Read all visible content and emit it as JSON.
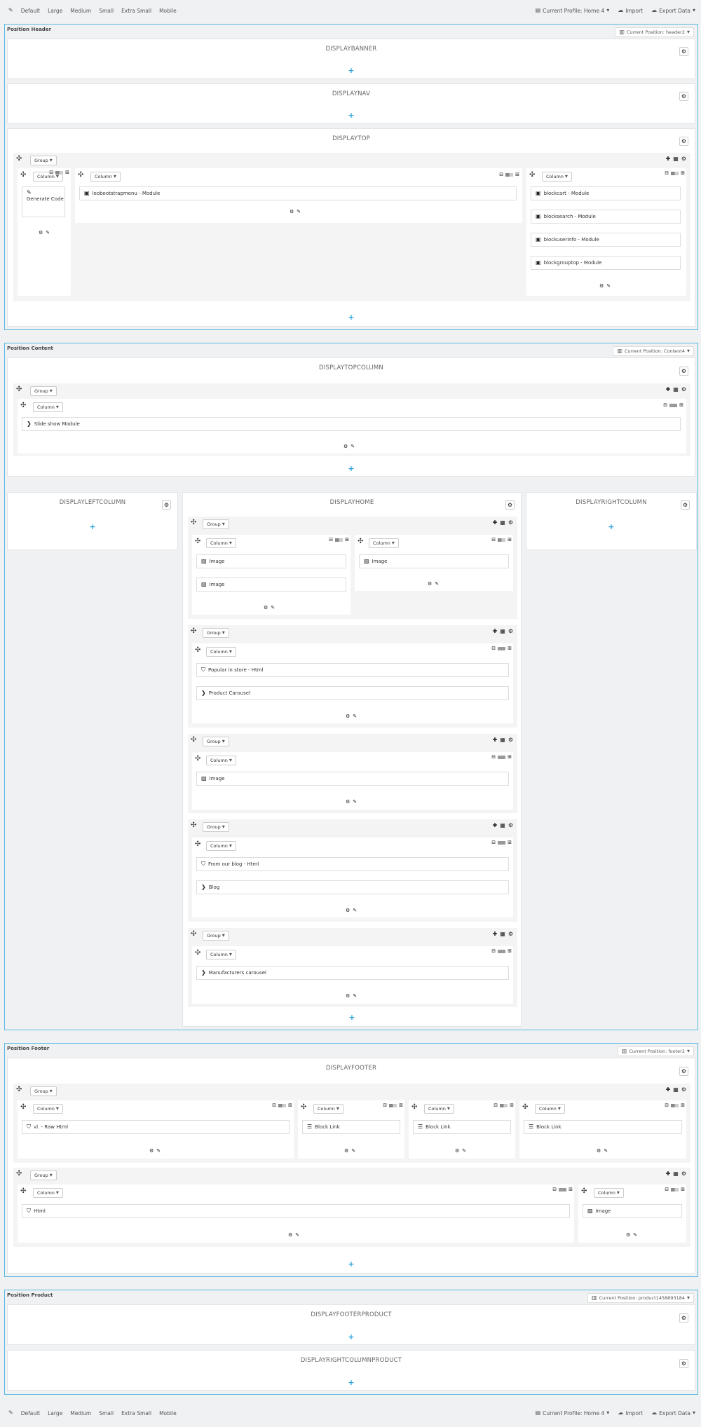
{
  "toolbar": {
    "edit_icon": "pencil-icon",
    "devices": [
      "Default",
      "Large",
      "Medium",
      "Small",
      "Extra Small",
      "Mobile"
    ],
    "profile_label": "Current Profile: Home 4",
    "import_label": "Import",
    "export_label": "Export Data"
  },
  "common": {
    "group_label": "Group",
    "column_label": "Column",
    "plus": "+"
  },
  "header": {
    "title": "Position Header",
    "current_position": "Current Position: header2",
    "hooks": {
      "banner": "DISPLAYBANNER",
      "nav": "DISPLAYNAV",
      "top": "DISPLAYTOP"
    },
    "top_group": {
      "col1": [
        "Generate Code"
      ],
      "col2": [
        "leobootstrapmenu - Module"
      ],
      "col3": [
        "blockcart - Module",
        "blocksearch - Module",
        "blockuserinfo - Module",
        "blockgrouptop - Module"
      ]
    }
  },
  "content": {
    "title": "Position Content",
    "current_position": "Current Position: Content4",
    "hooks": {
      "topcolumn": "DISPLAYTOPCOLUMN",
      "left": "DISPLAYLEFTCOLUMN",
      "home": "DISPLAYHOME",
      "right": "DISPLAYRIGHTCOLUMN"
    },
    "topcolumn_module": "Slide show Module",
    "home_groups": {
      "g1_col1": [
        "Image",
        "Image"
      ],
      "g1_col2": [
        "Image"
      ],
      "g2": [
        "Popular in store - Html",
        "Product Carousel"
      ],
      "g3": [
        "Image"
      ],
      "g4": [
        "From our blog - Html",
        "Blog"
      ],
      "g5": [
        "Manufacturers carousel"
      ]
    }
  },
  "footer": {
    "title": "Position Footer",
    "current_position": "Current Position: footer2",
    "hook": "DISPLAYFOOTER",
    "g1": [
      "vl. - Raw Html",
      "Block Link",
      "Block Link",
      "Block Link"
    ],
    "g2": [
      "Html",
      "Image"
    ]
  },
  "product": {
    "title": "Position Product",
    "current_position": "Current Position: product1458893184",
    "hooks": {
      "footer": "DISPLAYFOOTERPRODUCT",
      "right": "DISPLAYRIGHTCOLUMNPRODUCT"
    }
  },
  "colors": {
    "accent": "#5bb9e3",
    "plus": "#2aa2d9",
    "bg": "#eff1f2"
  }
}
